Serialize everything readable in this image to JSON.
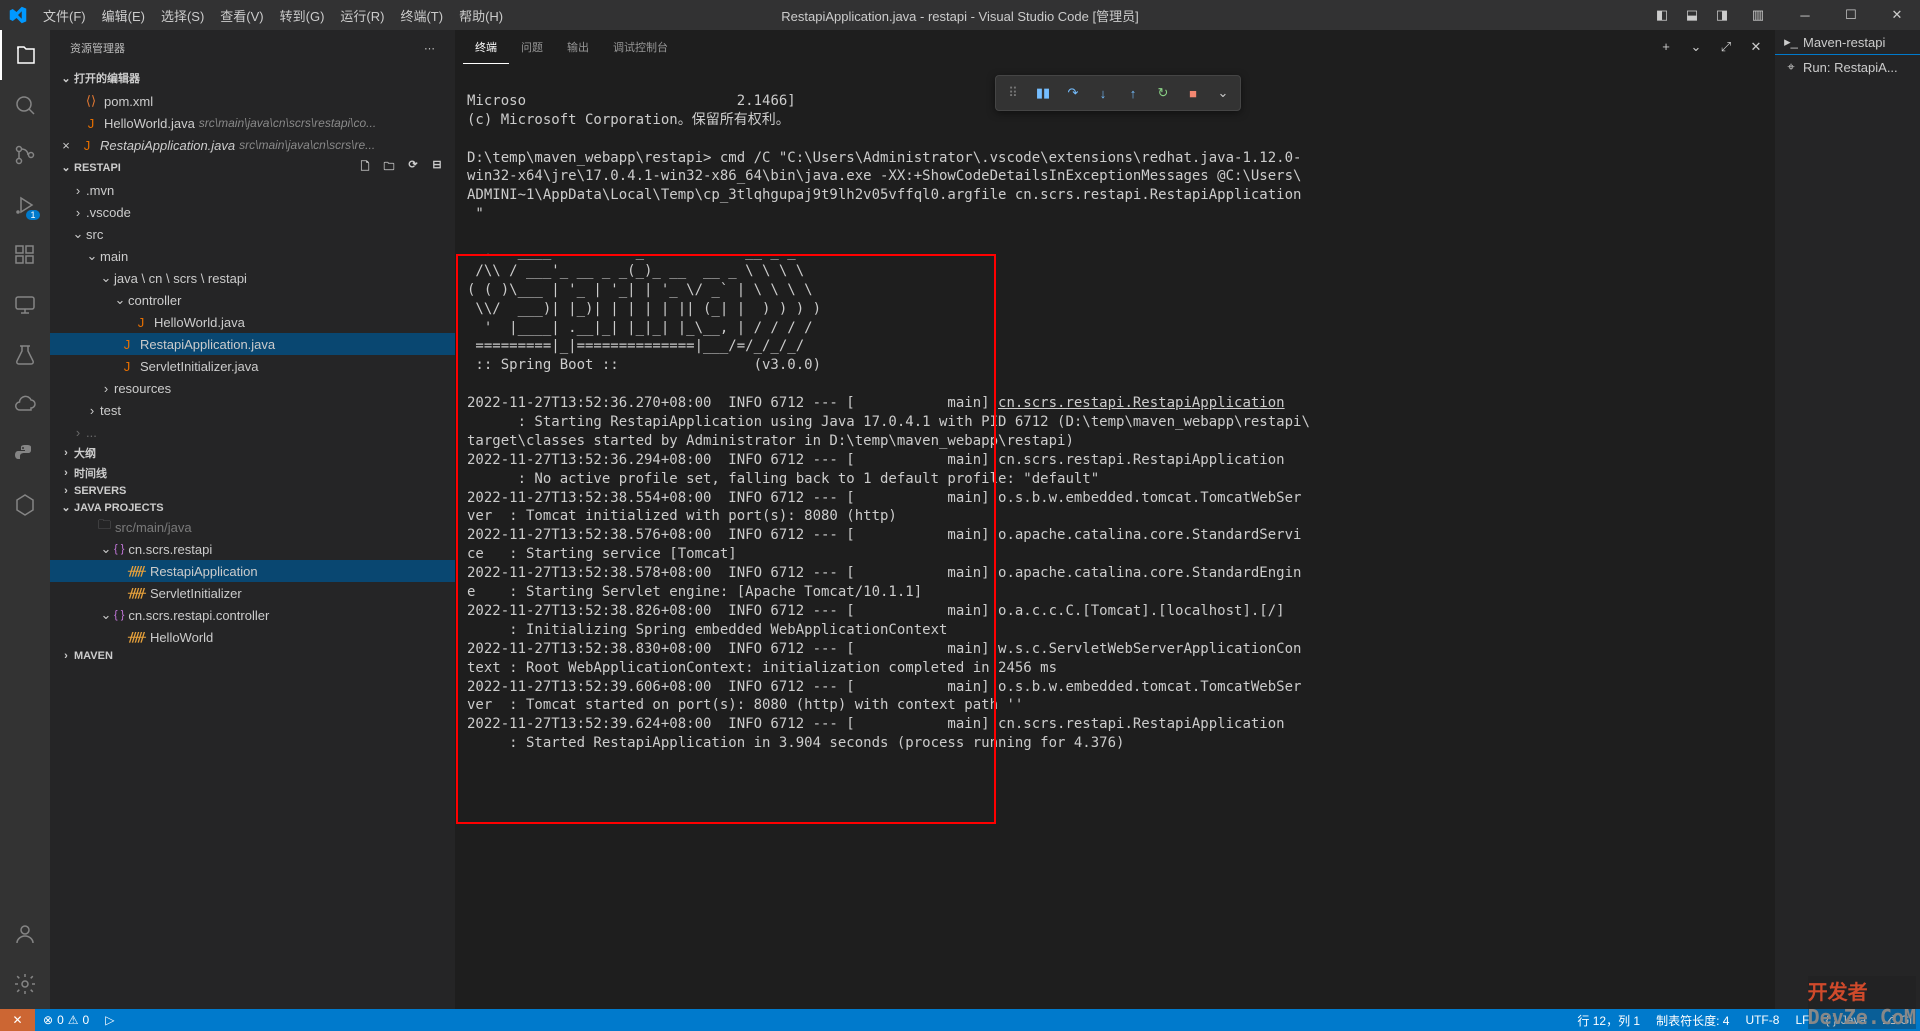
{
  "title": "RestapiApplication.java - restapi - Visual Studio Code [管理员]",
  "menu": [
    "文件(F)",
    "编辑(E)",
    "选择(S)",
    "查看(V)",
    "转到(G)",
    "运行(R)",
    "终端(T)",
    "帮助(H)"
  ],
  "sidebar": {
    "title": "资源管理器",
    "openEditors": "打开的编辑器",
    "files": [
      {
        "name": "pom.xml",
        "path": ""
      },
      {
        "name": "HelloWorld.java",
        "path": "src\\main\\java\\cn\\scrs\\restapi\\co..."
      },
      {
        "name": "RestapiApplication.java",
        "path": "src\\main\\java\\cn\\scrs\\re...",
        "active": true
      }
    ],
    "project": "RESTAPI",
    "tree": {
      "mvn": ".mvn",
      "vscode": ".vscode",
      "src": "src",
      "main": "main",
      "pkg": "java \\ cn \\ scrs \\ restapi",
      "controller": "controller",
      "hello": "HelloWorld.java",
      "app": "RestapiApplication.java",
      "servlet": "ServletInitializer.java",
      "resources": "resources",
      "test": "test"
    },
    "outline": "大纲",
    "timeline": "时间线",
    "servers": "SERVERS",
    "javaProjects": "JAVA PROJECTS",
    "jp": {
      "folder": "src/main/java",
      "pkg1": "cn.scrs.restapi",
      "cls1": "RestapiApplication",
      "cls2": "ServletInitializer",
      "pkg2": "cn.scrs.restapi.controller",
      "cls3": "HelloWorld"
    },
    "maven": "MAVEN"
  },
  "panel": {
    "tabs": [
      "终端",
      "问题",
      "输出",
      "调试控制台"
    ]
  },
  "terminal": {
    "l1": "Microso",
    "l1b": "2.1466]",
    "l2": "(c) Microsoft Corporation。保留所有权利。",
    "l3": "D:\\temp\\maven_webapp\\restapi> cmd /C \"C:\\Users\\Administrator\\.vscode\\extensions\\redhat.java-1.12.0-",
    "l4": "win32-x64\\jre\\17.0.4.1-win32-x86_64\\bin\\java.exe -XX:+ShowCodeDetailsInExceptionMessages @C:\\Users\\",
    "l5": "ADMINI~1\\AppData\\Local\\Temp\\cp_3tlqhgupaj9t9lh2v05vffql0.argfile cn.scrs.restapi.RestapiApplication",
    "l6": " \"",
    "ascii": "  .   ____          _            __ _ _\n /\\\\ / ___'_ __ _ _(_)_ __  __ _ \\ \\ \\ \\\n( ( )\\___ | '_ | '_| | '_ \\/ _` | \\ \\ \\ \\\n \\\\/  ___)| |_)| | | | | || (_| |  ) ) ) )\n  '  |____| .__|_| |_|_| |_\\__, | / / / /\n =========|_|==============|___/=/_/_/_/\n :: Spring Boot ::                (v3.0.0)",
    "log1a": "2022-11-27T13:52:36.270+08:00  INFO 6712 --- [           main] ",
    "log1b": "cn.scrs.restapi.RestapiApplication",
    "log1c": "      : Starting RestapiApplication using Java 17.0.4.1 with PID 6712 (D:\\temp\\maven_webapp\\restapi\\",
    "log1d": "target\\classes started by Administrator in D:\\temp\\maven_webapp\\restapi)",
    "log2": "2022-11-27T13:52:36.294+08:00  INFO 6712 --- [           main] cn.scrs.restapi.RestapiApplication",
    "log2b": "      : No active profile set, falling back to 1 default profile: \"default\"",
    "log3": "2022-11-27T13:52:38.554+08:00  INFO 6712 --- [           main] o.s.b.w.embedded.tomcat.TomcatWebSer",
    "log3b": "ver  : Tomcat initialized with port(s): 8080 (http)",
    "log4": "2022-11-27T13:52:38.576+08:00  INFO 6712 --- [           main] o.apache.catalina.core.StandardServi",
    "log4b": "ce   : Starting service [Tomcat]",
    "log5": "2022-11-27T13:52:38.578+08:00  INFO 6712 --- [           main] o.apache.catalina.core.StandardEngin",
    "log5b": "e    : Starting Servlet engine: [Apache Tomcat/10.1.1]",
    "log6": "2022-11-27T13:52:38.826+08:00  INFO 6712 --- [           main] o.a.c.c.C.[Tomcat].[localhost].[/]",
    "log6b": "     : Initializing Spring embedded WebApplicationContext",
    "log7": "2022-11-27T13:52:38.830+08:00  INFO 6712 --- [           main] w.s.c.ServletWebServerApplicationCon",
    "log7b": "text : Root WebApplicationContext: initialization completed in 2456 ms",
    "log8": "2022-11-27T13:52:39.606+08:00  INFO 6712 --- [           main] o.s.b.w.embedded.tomcat.TomcatWebSer",
    "log8b": "ver  : Tomcat started on port(s): 8080 (http) with context path ''",
    "log9": "2022-11-27T13:52:39.624+08:00  INFO 6712 --- [           main] cn.scrs.restapi.RestapiApplication",
    "log9b": "     : Started RestapiApplication in 3.904 seconds (process running for 4.376)"
  },
  "rightPanel": {
    "item1": "Maven-restapi",
    "item2": "Run: RestapiA..."
  },
  "status": {
    "errors": "0",
    "warnings": "0",
    "cursor": "行 12，列 1",
    "tab": "制表符长度: 4",
    "encoding": "UTF-8",
    "eol": "LF",
    "lang": "Java",
    "git": "Gi"
  },
  "watermark": {
    "a": "开发者",
    "b": "DevZe.CoM"
  }
}
